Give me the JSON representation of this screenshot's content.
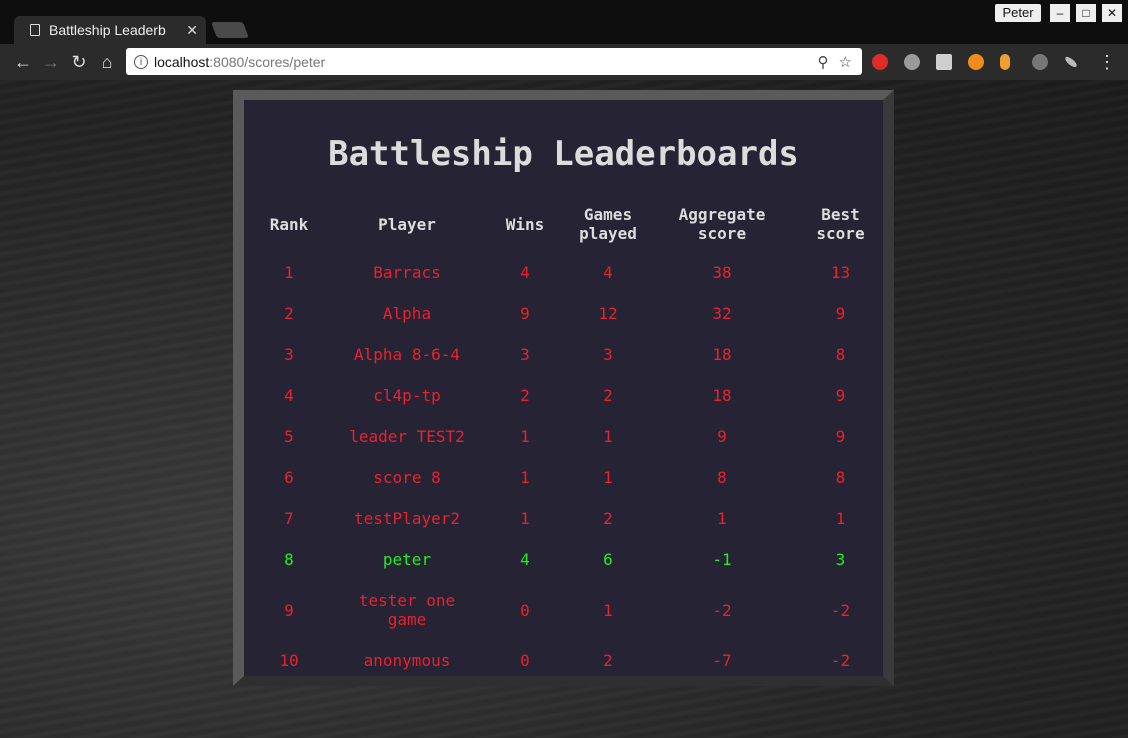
{
  "browser": {
    "tab_title": "Battleship Leaderb",
    "tab_close": "✕",
    "profile_name": "Peter",
    "url_host": "localhost",
    "url_rest": ":8080/scores/peter",
    "icons": [
      "page-icon",
      "close-icon",
      "back-icon",
      "forward-icon",
      "reload-icon",
      "home-icon",
      "info-icon",
      "zoom-icon",
      "star-icon",
      "menu-icon"
    ]
  },
  "page": {
    "title": "Battleship Leaderboards",
    "headers": {
      "rank": "Rank",
      "player": "Player",
      "wins": "Wins",
      "games_1": "Games",
      "games_2": "played",
      "agg_1": "Aggregate",
      "agg_2": "score",
      "best_1": "Best",
      "best_2": "score"
    },
    "colors": {
      "other": "#e8222e",
      "current_user": "#22ee22"
    },
    "rows": [
      {
        "rank": "1",
        "player": "Barracs",
        "wins": "4",
        "games": "4",
        "aggregate": "38",
        "best": "13"
      },
      {
        "rank": "2",
        "player": "Alpha",
        "wins": "9",
        "games": "12",
        "aggregate": "32",
        "best": "9"
      },
      {
        "rank": "3",
        "player": "Alpha 8-6-4",
        "wins": "3",
        "games": "3",
        "aggregate": "18",
        "best": "8"
      },
      {
        "rank": "4",
        "player": "cl4p-tp",
        "wins": "2",
        "games": "2",
        "aggregate": "18",
        "best": "9"
      },
      {
        "rank": "5",
        "player": "leader TEST2",
        "wins": "1",
        "games": "1",
        "aggregate": "9",
        "best": "9"
      },
      {
        "rank": "6",
        "player": "score 8",
        "wins": "1",
        "games": "1",
        "aggregate": "8",
        "best": "8"
      },
      {
        "rank": "7",
        "player": "testPlayer2",
        "wins": "1",
        "games": "2",
        "aggregate": "1",
        "best": "1"
      },
      {
        "rank": "8",
        "player": "peter",
        "wins": "4",
        "games": "6",
        "aggregate": "-1",
        "best": "3"
      },
      {
        "rank": "9",
        "player_1": "tester one",
        "player_2": "game",
        "wins": "0",
        "games": "1",
        "aggregate": "-2",
        "best": "-2"
      },
      {
        "rank": "10",
        "player": "anonymous",
        "wins": "0",
        "games": "2",
        "aggregate": "-7",
        "best": "-2"
      }
    ]
  }
}
